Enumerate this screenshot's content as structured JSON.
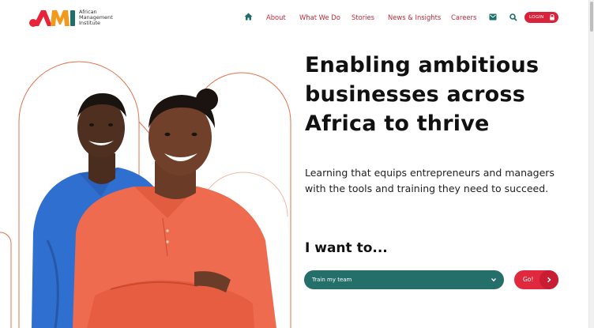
{
  "logo": {
    "line1": "African",
    "line2": "Management",
    "line3": "Institute",
    "mark_letters": "AMI",
    "colors": [
      "#e8243b",
      "#f39a1d",
      "#1e6f69"
    ]
  },
  "nav": {
    "home_icon": "home-icon",
    "items": [
      {
        "label": "About"
      },
      {
        "label": "What We Do"
      },
      {
        "label": "Stories"
      },
      {
        "label": "News & Insights"
      },
      {
        "label": "Careers"
      }
    ],
    "mail_icon": "mail-icon",
    "search_icon": "search-icon",
    "login_label": "LOGIN",
    "lock_icon": "lock-icon",
    "accent_color": "#c72a3a"
  },
  "hero": {
    "headline": "Enabling ambitious businesses across Africa to thrive",
    "subtext": "Learning that equips entrepreneurs and managers with the tools and training they need to succeed.",
    "cta_heading": "I want to...",
    "select_value": "Train my team",
    "go_label": "Go!",
    "select_color": "#246f6a",
    "button_color": "#e0283f"
  }
}
